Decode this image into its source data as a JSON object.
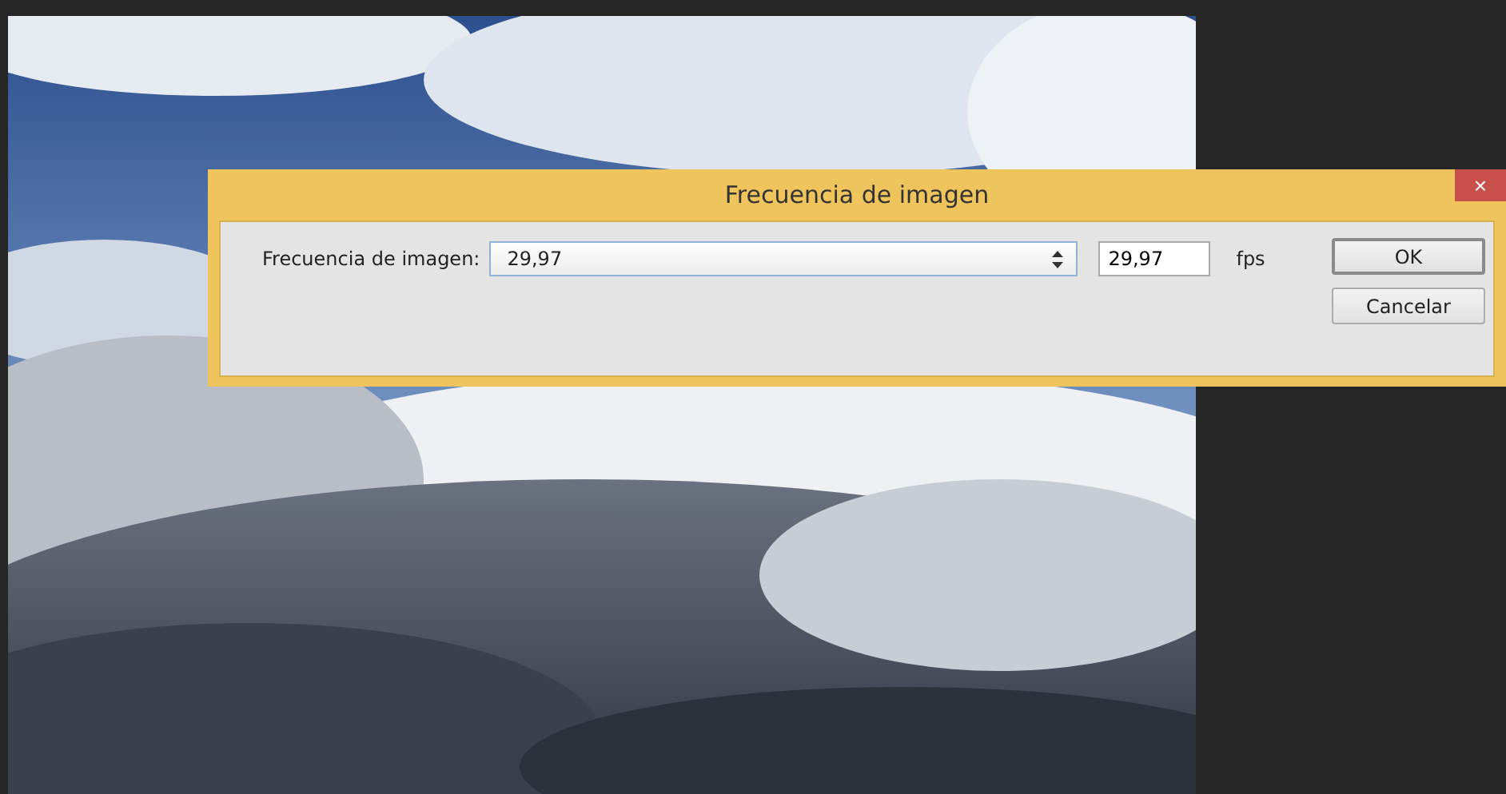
{
  "dialog": {
    "title": "Frecuencia de imagen",
    "close": "×",
    "label": "Frecuencia de imagen:",
    "select_value": "29,97",
    "input_value": "29,97",
    "unit": "fps",
    "buttons": [
      {
        "label": "OK",
        "default": true
      },
      {
        "label": "Cancelar",
        "default": false
      }
    ]
  }
}
